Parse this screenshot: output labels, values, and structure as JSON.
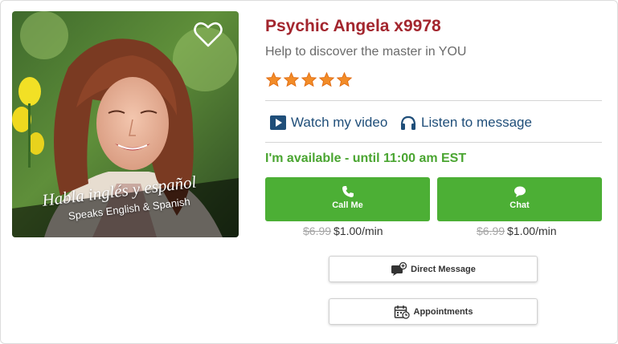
{
  "psychic": {
    "name": "Psychic Angela x9978",
    "tagline": "Help to discover the master in YOU",
    "rating_stars": 5,
    "photo_banner": {
      "main": "Habla inglés y español",
      "sub": "Speaks English & Spanish"
    }
  },
  "media": {
    "video_label": "Watch my video",
    "audio_label": "Listen to message"
  },
  "availability": "I'm available - until 11:00 am EST",
  "actions": {
    "call": {
      "label": "Call Me",
      "old_price": "$6.99",
      "price": "$1.00/min"
    },
    "chat": {
      "label": "Chat",
      "old_price": "$6.99",
      "price": "$1.00/min"
    },
    "message": {
      "label": "Direct Message"
    },
    "appointments": {
      "label": "Appointments"
    }
  },
  "colors": {
    "name": "#a3262e",
    "available": "#4aa531",
    "button_green": "#4caf35",
    "link_blue": "#1f4e79",
    "star": "#f28c28"
  },
  "icons": [
    "heart-icon",
    "star-icon",
    "video-play-icon",
    "headphones-icon",
    "phone-icon",
    "chat-bubble-icon",
    "message-icon",
    "calendar-icon"
  ]
}
